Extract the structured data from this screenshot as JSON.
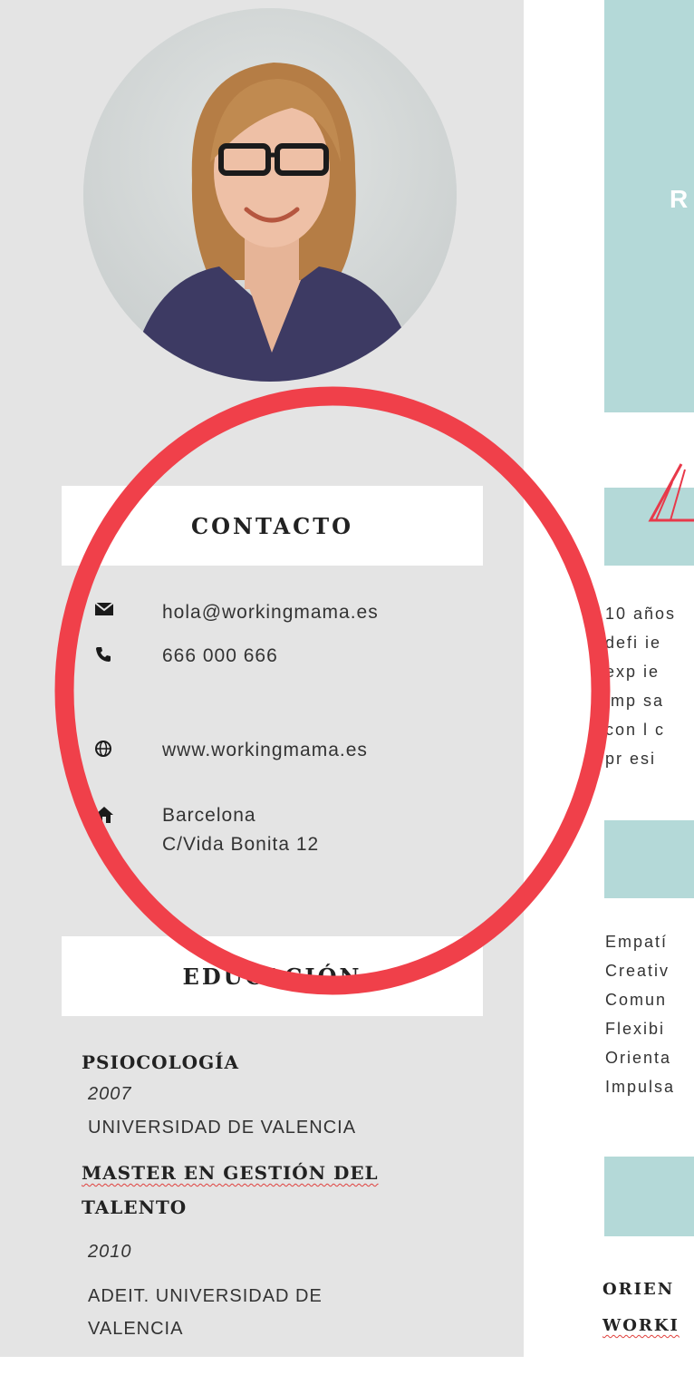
{
  "contact": {
    "heading": "CONTACTO",
    "email": "hola@workingmama.es",
    "phone": "666 000 666",
    "web": "www.workingmama.es",
    "address_line1": "Barcelona",
    "address_line2": "C/Vida Bonita 12"
  },
  "education": {
    "heading": "EDUCACIÓN",
    "items": [
      {
        "title": "PSIOCOLOGÍA",
        "year": "2007",
        "school": "UNIVERSIDAD DE VALENCIA"
      },
      {
        "title_line1": "MASTER EN GESTIÓN DEL",
        "title_line2": "TALENTO",
        "year": "2010",
        "school_line1": "ADEIT. UNIVERSIDAD DE",
        "school_line2": "VALENCIA"
      }
    ]
  },
  "right_column": {
    "header_letter": "R",
    "summary_lines": [
      "10 años",
      "defi ie",
      "exp ie",
      "imp sa",
      "con l c",
      "pr esi"
    ],
    "skills": [
      "Empatí",
      "Creativ",
      "Comun",
      "Flexibi",
      "Orienta",
      "Impulsa"
    ],
    "bottom_lines": [
      "ORIEN",
      "WORKI"
    ]
  },
  "colors": {
    "sidebar": "#e4e4e4",
    "teal": "#b4d9d8",
    "annotation_circle": "#f0404a"
  }
}
